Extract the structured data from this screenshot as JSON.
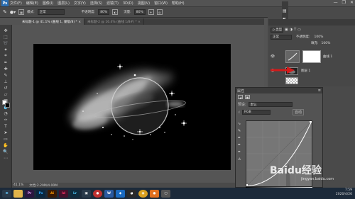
{
  "app": {
    "logo": "Ps"
  },
  "menubar": {
    "items": [
      "文件(F)",
      "编辑(E)",
      "图像(I)",
      "图层(L)",
      "文字(Y)",
      "选择(S)",
      "滤镜(T)",
      "3D(D)",
      "视图(V)",
      "窗口(W)",
      "帮助(H)"
    ]
  },
  "window_controls": {
    "minimize": "—",
    "maximize": "❐",
    "close": "✕"
  },
  "options": {
    "mode_label": "模式:",
    "mode_value": "正常",
    "opacity_label": "不透明度:",
    "opacity_value": "80%",
    "flow_label": "流量:",
    "flow_value": "80%"
  },
  "tabs": [
    {
      "label": "未标题-1 @ 41.1% (曲线 1, 蒙版/8) * ×"
    },
    {
      "label": "未标题-2 @ 16.4% (曲线 1/8#) * ×"
    }
  ],
  "status": {
    "zoom": "41.1%",
    "doc": "文档:2.29M/4.00M"
  },
  "layers_panel": {
    "search_placeholder": "p 类型",
    "blend_mode": "正常",
    "opacity_label": "不透明度:",
    "opacity_value": "100%",
    "fill_label": "填充:",
    "fill_value": "100%",
    "layers": [
      {
        "name": "曲线 1"
      },
      {
        "name": "图层 1"
      }
    ]
  },
  "properties_panel": {
    "title": "属性",
    "preset_label": "预设:",
    "preset_value": "默认",
    "channel_value": "RGB",
    "auto_label": "自动"
  },
  "taskbar": {
    "apps": [
      {
        "name": "start",
        "label": "",
        "color": "#1c2a3a"
      },
      {
        "name": "explorer",
        "label": "",
        "color": "#e0b44a"
      },
      {
        "name": "premiere",
        "label": "Pr",
        "color": "#2a1640"
      },
      {
        "name": "photoshop",
        "label": "Ps",
        "color": "#0a2740"
      },
      {
        "name": "illustrator",
        "label": "Ai",
        "color": "#3a1a04"
      },
      {
        "name": "indesign",
        "label": "Id",
        "color": "#45102b"
      },
      {
        "name": "lightroom",
        "label": "Lr",
        "color": "#0f2c3e"
      },
      {
        "name": "media",
        "label": "",
        "color": "#2a3a4a"
      },
      {
        "name": "app-red",
        "label": "",
        "color": "#c03030"
      },
      {
        "name": "word",
        "label": "",
        "color": "#2a5aa0"
      },
      {
        "name": "app-blue",
        "label": "",
        "color": "#1a6ac0"
      },
      {
        "name": "qq",
        "label": "",
        "color": "#2a2a2a"
      },
      {
        "name": "chrome",
        "label": "",
        "color": "#d9a020"
      },
      {
        "name": "app-orange",
        "label": "",
        "color": "#e07020"
      },
      {
        "name": "app-grey",
        "label": "",
        "color": "#555"
      }
    ],
    "time": "7:59",
    "date": "2020/4/26"
  },
  "watermark": {
    "text": "Baidu经验",
    "url": "jingyan.baidu.com"
  },
  "colors": {
    "accent": "#2b6fb3",
    "panel": "#535353",
    "dark": "#3a3a3a",
    "arrow": "#d21a1a"
  }
}
